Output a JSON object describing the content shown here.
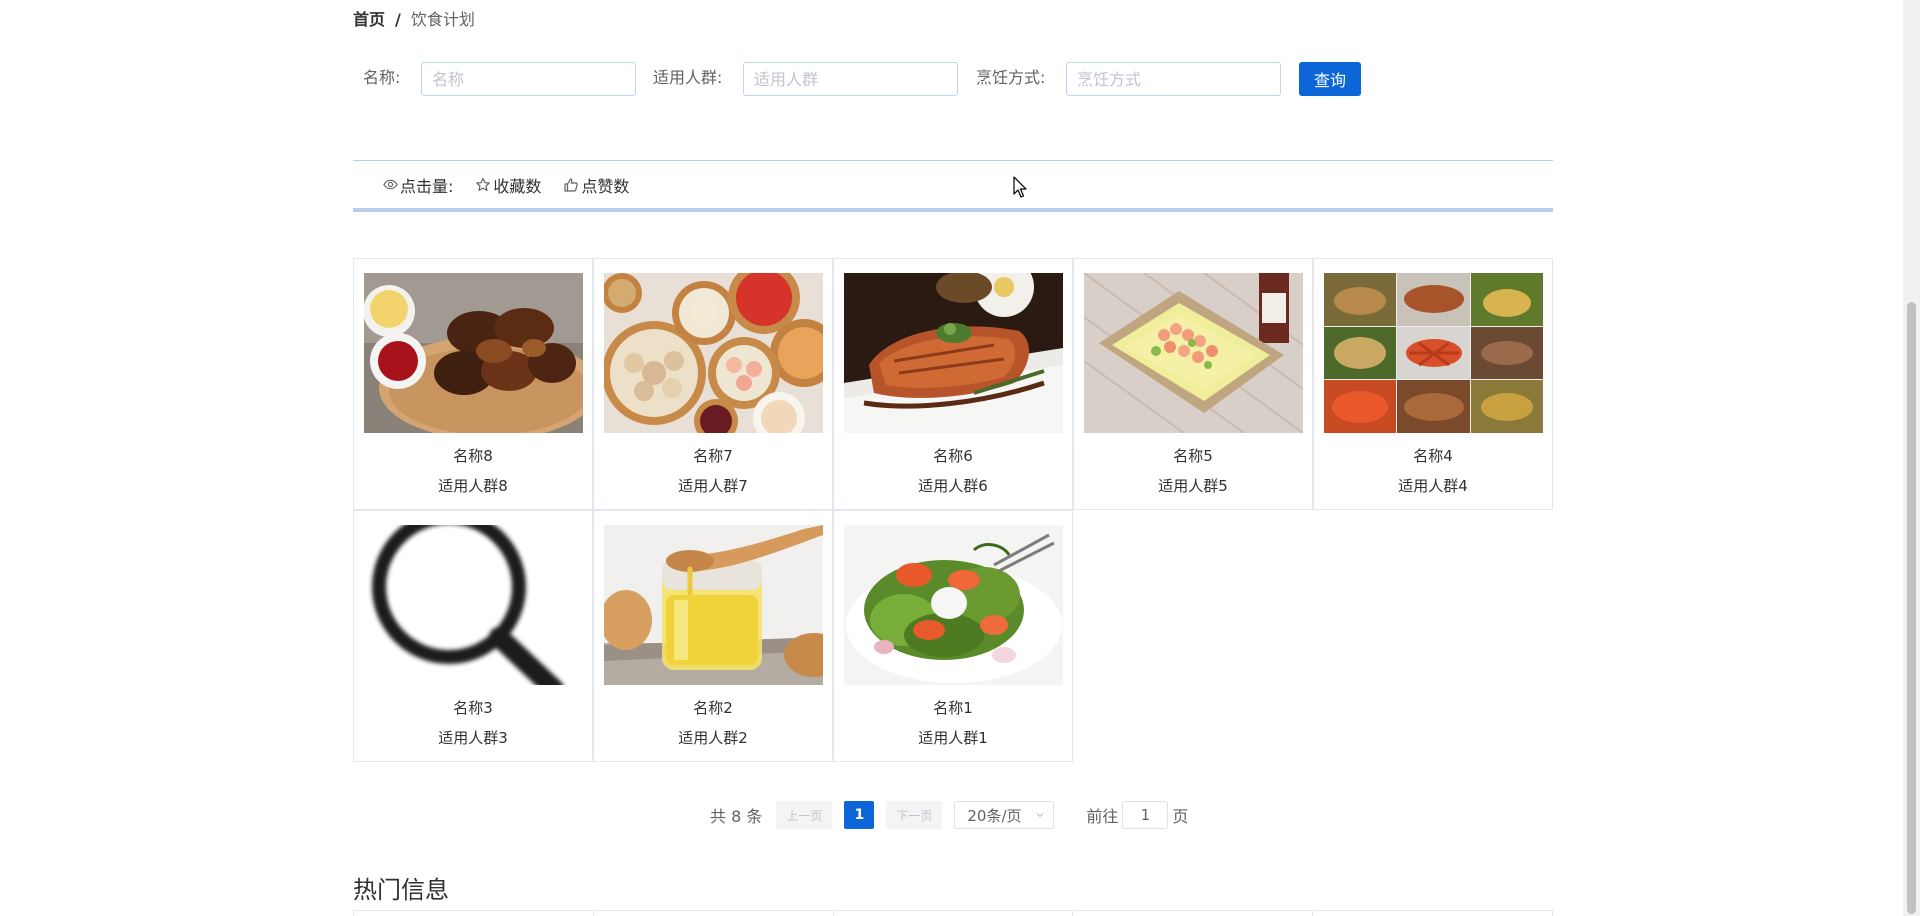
{
  "breadcrumb": {
    "home": "首页",
    "separator": "/",
    "current": "饮食计划"
  },
  "search": {
    "name_label": "名称:",
    "name_placeholder": "名称",
    "name_value": "",
    "group_label": "适用人群:",
    "group_placeholder": "适用人群",
    "group_value": "",
    "method_label": "烹饪方式:",
    "method_placeholder": "烹饪方式",
    "method_value": "",
    "query_label": "查询"
  },
  "sort": {
    "clicks_label": "点击量:",
    "favorites_label": "收藏数",
    "likes_label": "点赞数"
  },
  "cards": [
    {
      "name": "名称8",
      "group": "适用人群8",
      "image": "grilled-chicken"
    },
    {
      "name": "名称7",
      "group": "适用人群7",
      "image": "dim-sum"
    },
    {
      "name": "名称6",
      "group": "适用人群6",
      "image": "salmon-steak"
    },
    {
      "name": "名称5",
      "group": "适用人群5",
      "image": "shrimp-plate"
    },
    {
      "name": "名称4",
      "group": "适用人群4",
      "image": "food-collage"
    },
    {
      "name": "名称3",
      "group": "适用人群3",
      "image": "magnifier-placeholder"
    },
    {
      "name": "名称2",
      "group": "适用人群2",
      "image": "honey-jar"
    },
    {
      "name": "名称1",
      "group": "适用人群1",
      "image": "salad"
    }
  ],
  "pagination": {
    "total": "共 8 条",
    "prev": "上一页",
    "current_page": "1",
    "next": "下一页",
    "page_size": "20条/页",
    "goto_label": "前往",
    "goto_value": "1",
    "page_suffix": "页"
  },
  "hot": {
    "title": "热门信息"
  },
  "colors": {
    "primary": "#0d66d8",
    "border_accent": "#b9cdee"
  }
}
